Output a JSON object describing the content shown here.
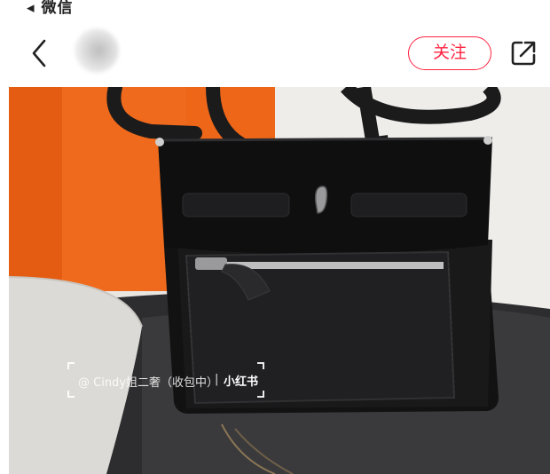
{
  "status_bar": {
    "back_app_label": "◂ 微信"
  },
  "nav": {
    "back_icon": "chevron-left-icon",
    "follow_label": "关注",
    "share_icon": "share-icon",
    "accent_color": "#ff2442"
  },
  "photo": {
    "watermark_user": "@ Cindy姐二奢（收包中）",
    "watermark_separator": "|",
    "watermark_brand": "小红书"
  }
}
